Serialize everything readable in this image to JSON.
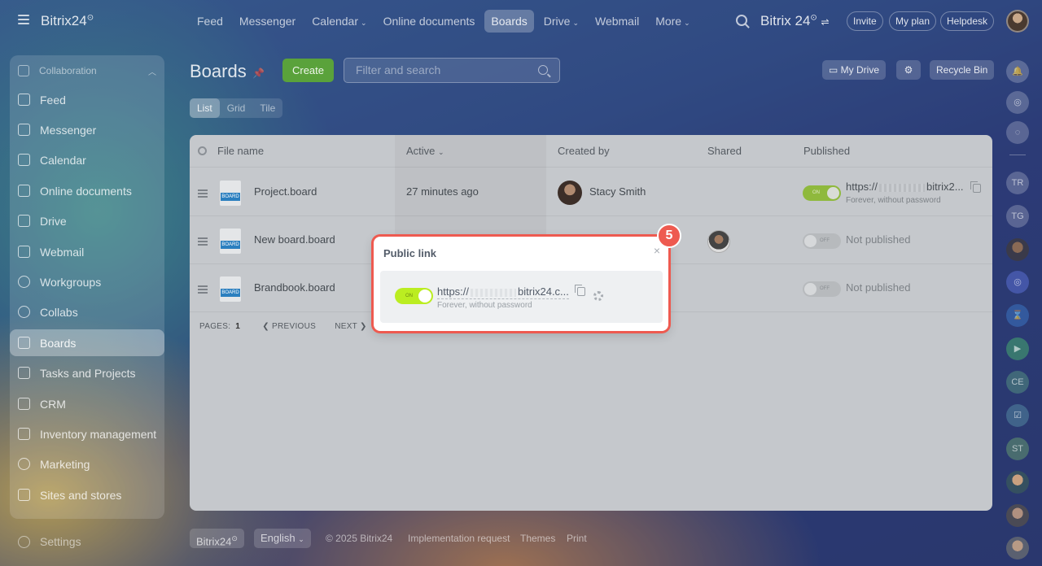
{
  "topbar": {
    "brand": "Bitrix24",
    "brand_mark": "⊙",
    "nav": [
      {
        "label": "Feed"
      },
      {
        "label": "Messenger"
      },
      {
        "label": "Calendar"
      },
      {
        "label": "Online documents"
      },
      {
        "label": "Boards"
      },
      {
        "label": "Drive"
      },
      {
        "label": "Webmail"
      },
      {
        "label": "More"
      }
    ],
    "brand2": "Bitrix 24",
    "invite": "Invite",
    "my_plan": "My plan",
    "helpdesk": "Helpdesk"
  },
  "sidebar": {
    "section": "Collaboration",
    "items": [
      {
        "label": "Feed"
      },
      {
        "label": "Messenger"
      },
      {
        "label": "Calendar"
      },
      {
        "label": "Online documents"
      },
      {
        "label": "Drive"
      },
      {
        "label": "Webmail"
      },
      {
        "label": "Workgroups"
      },
      {
        "label": "Collabs"
      },
      {
        "label": "Boards"
      },
      {
        "label": "Tasks and Projects"
      },
      {
        "label": "CRM"
      },
      {
        "label": "Inventory management"
      },
      {
        "label": "Marketing"
      },
      {
        "label": "Sites and stores"
      }
    ],
    "settings": "Settings"
  },
  "page": {
    "title": "Boards",
    "create": "Create",
    "filter_placeholder": "Filter and search",
    "my_drive": "My Drive",
    "recycle_bin": "Recycle Bin",
    "views": [
      "List",
      "Grid",
      "Tile"
    ]
  },
  "table": {
    "headers": {
      "file_name": "File name",
      "active": "Active",
      "created_by": "Created by",
      "shared": "Shared",
      "published": "Published"
    },
    "rows": [
      {
        "name": "Project.board",
        "active": "27 minutes ago",
        "created_by": "Stacy Smith",
        "link_start": "https://",
        "link_end": "bitrix2...",
        "link_sub": "Forever, without password",
        "toggle": "ON"
      },
      {
        "name": "New board.board",
        "status": "Not published",
        "toggle": "OFF"
      },
      {
        "name": "Brandbook.board",
        "status": "Not published",
        "toggle": "OFF"
      }
    ],
    "file_badge": "BOARD",
    "pager": {
      "label": "PAGES:",
      "current": "1",
      "previous": "PREVIOUS",
      "next": "NEXT"
    }
  },
  "popup": {
    "title": "Public link",
    "close": "×",
    "toggle": "ON",
    "link_start": "https://",
    "link_end": "bitrix24.c...",
    "sub": "Forever, without password",
    "step": "5"
  },
  "footer": {
    "brand": "Bitrix24",
    "language": "English",
    "copyright": "© 2025 Bitrix24",
    "implementation": "Implementation request",
    "themes": "Themes",
    "print": "Print"
  },
  "rail": [
    "TR",
    "TG",
    "CE",
    "ST"
  ],
  "colors": {
    "accent_green": "#5aa23b",
    "toggle_on": "#bbed21",
    "highlight": "#ee5a50"
  }
}
